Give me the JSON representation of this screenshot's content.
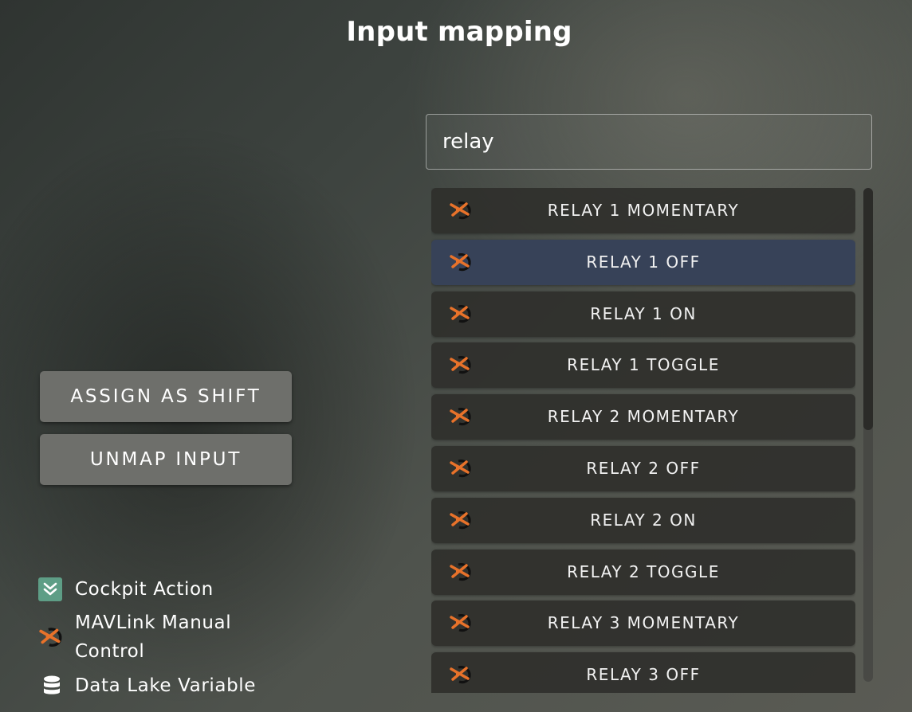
{
  "title": "Input mapping",
  "search": {
    "value": "relay"
  },
  "actions": {
    "assign_shift_label": "ASSIGN AS SHIFT",
    "unmap_label": "UNMAP INPUT"
  },
  "list": {
    "icon": "mavlink-drone-icon",
    "selected_index": 1,
    "items": [
      {
        "label": "RELAY 1 MOMENTARY"
      },
      {
        "label": "RELAY 1 OFF"
      },
      {
        "label": "RELAY 1 ON"
      },
      {
        "label": "RELAY 1 TOGGLE"
      },
      {
        "label": "RELAY 2 MOMENTARY"
      },
      {
        "label": "RELAY 2 OFF"
      },
      {
        "label": "RELAY 2 ON"
      },
      {
        "label": "RELAY 2 TOGGLE"
      },
      {
        "label": "RELAY 3 MOMENTARY"
      },
      {
        "label": "RELAY 3 OFF"
      }
    ]
  },
  "legend": {
    "cockpit_action": {
      "label": "Cockpit Action",
      "icon": "cockpit-action-icon",
      "color": "#5e9e86"
    },
    "mavlink": {
      "label_line1": "MAVLink Manual",
      "label_line2": "Control",
      "icon": "mavlink-drone-icon",
      "color": "#e8722a"
    },
    "data_lake": {
      "label": "Data Lake Variable",
      "icon": "database-icon"
    }
  },
  "colors": {
    "selected_item": "#374258",
    "button": "#6e6f6b",
    "accent_orange": "#e8722a"
  }
}
